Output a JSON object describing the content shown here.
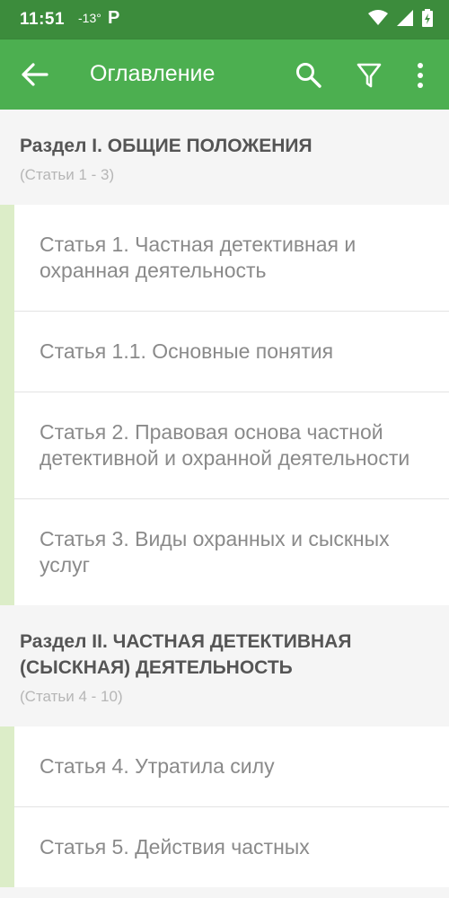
{
  "status_bar": {
    "time": "11:51",
    "temperature": "-13°",
    "app_badge": "P"
  },
  "toolbar": {
    "title": "Оглавление",
    "icons": [
      "back-arrow-icon",
      "search-icon",
      "filter-icon",
      "more-vert-icon"
    ]
  },
  "sections": [
    {
      "title": "Раздел I. ОБЩИЕ ПОЛОЖЕНИЯ",
      "subtitle": "(Статьи 1 - 3)",
      "articles": [
        "Статья 1. Частная детективная и охранная деятельность",
        "Статья 1.1. Основные понятия",
        "Статья 2. Правовая основа частной детективной и охранной деятельности",
        "Статья 3. Виды охранных и сыскных услуг"
      ]
    },
    {
      "title": "Раздел II. ЧАСТНАЯ ДЕТЕКТИВНАЯ (СЫСКНАЯ) ДЕЯТЕЛЬНОСТЬ",
      "subtitle": "(Статьи 4 - 10)",
      "articles": [
        "Статья 4. Утратила силу",
        "Статья 5. Действия частных"
      ]
    }
  ],
  "colors": {
    "status_bar": "#3c8c3c",
    "toolbar": "#4caf50",
    "group_accent": "#dcedc8"
  }
}
